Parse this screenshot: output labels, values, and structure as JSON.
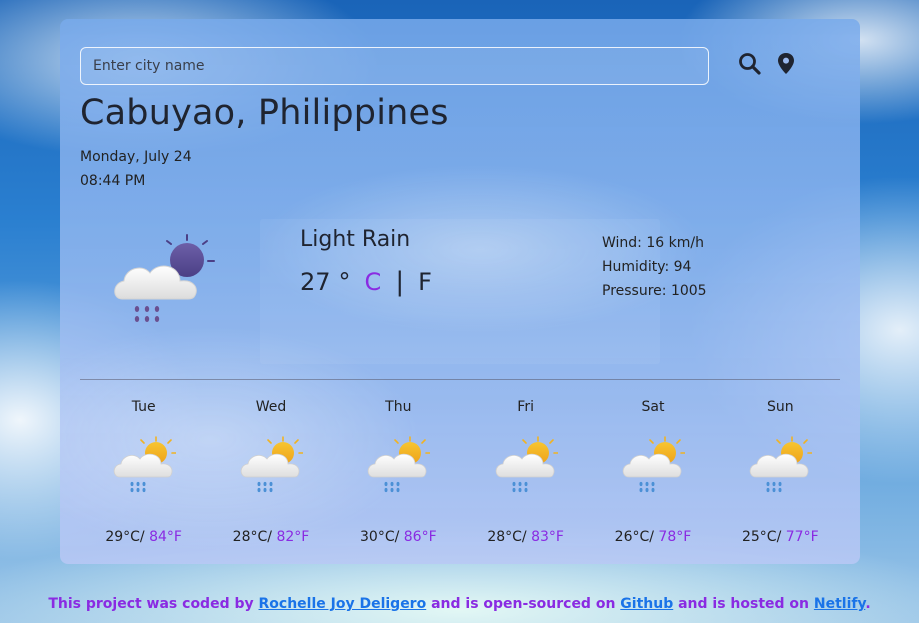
{
  "search": {
    "placeholder": "Enter city name"
  },
  "icons": {
    "search": "search-icon",
    "location": "location-pin-icon"
  },
  "current": {
    "city": "Cabuyao, Philippines",
    "date": "Monday, July 24",
    "time": "08:44 PM",
    "description": "Light Rain",
    "temperature": "27",
    "degree_symbol": "°",
    "unit_c": "C",
    "separator": "|",
    "unit_f": "F",
    "icon": "night-cloud-rain-icon",
    "wind": "Wind: 16 km/h",
    "humidity": "Humidity: 94",
    "pressure": "Pressure: 1005"
  },
  "forecast": [
    {
      "day": "Tue",
      "celsius": "29°C/",
      "fahrenheit": "84°F",
      "icon": "sun-cloud-rain-icon"
    },
    {
      "day": "Wed",
      "celsius": "28°C/",
      "fahrenheit": "82°F",
      "icon": "sun-cloud-rain-icon"
    },
    {
      "day": "Thu",
      "celsius": "30°C/",
      "fahrenheit": "86°F",
      "icon": "sun-cloud-rain-icon"
    },
    {
      "day": "Fri",
      "celsius": "28°C/",
      "fahrenheit": "83°F",
      "icon": "sun-cloud-rain-icon"
    },
    {
      "day": "Sat",
      "celsius": "26°C/",
      "fahrenheit": "78°F",
      "icon": "sun-cloud-rain-icon"
    },
    {
      "day": "Sun",
      "celsius": "25°C/",
      "fahrenheit": "77°F",
      "icon": "sun-cloud-rain-icon"
    }
  ],
  "footer": {
    "text1": "This project was coded by ",
    "author_link": "Rochelle Joy Deligero",
    "text2": " and is open-sourced on ",
    "github_link": "Github",
    "text3": " and is hosted on ",
    "netlify_link": "Netlify",
    "text4": "."
  },
  "colors": {
    "accent": "#8a2be2",
    "link": "#1a73e8"
  }
}
